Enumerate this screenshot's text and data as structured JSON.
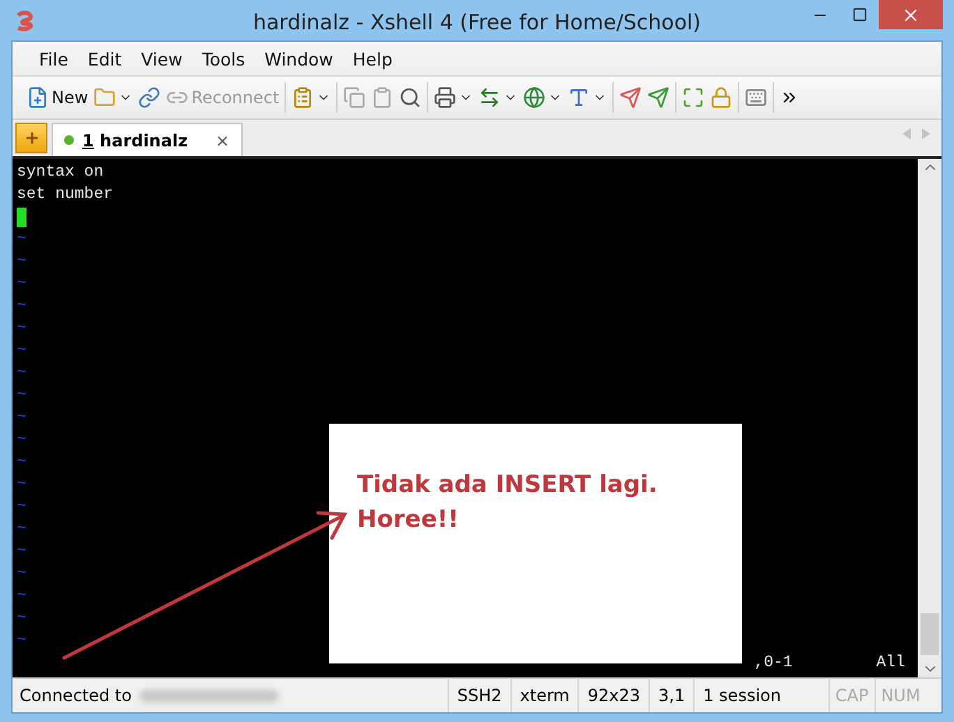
{
  "window": {
    "title": "hardinalz - Xshell 4 (Free for Home/School)"
  },
  "menu": [
    "File",
    "Edit",
    "View",
    "Tools",
    "Window",
    "Help"
  ],
  "toolbar": {
    "new_button": {
      "label": "New"
    },
    "reconnect_button": {
      "label": "Reconnect",
      "disabled": true
    }
  },
  "tabs": [
    {
      "number": "1",
      "label": "hardinalz",
      "selected": true,
      "connected": true,
      "close": "×"
    }
  ],
  "terminal": {
    "lines": [
      "syntax on",
      "set number"
    ],
    "cursor": true,
    "tildes": [
      "~",
      "~",
      "~",
      "~",
      "~",
      "~",
      "~",
      "~",
      "~",
      "~",
      "~",
      "~",
      "~",
      "~",
      "~",
      "~",
      "~",
      "~",
      "~"
    ],
    "ruler": ",0-1",
    "position": "All"
  },
  "annotation": {
    "lines": [
      "Tidak ada INSERT lagi.",
      "Horee!!"
    ]
  },
  "status_bar": {
    "message": "Connected to",
    "cells": [
      "SSH2",
      "xterm",
      "92x23",
      "3,1",
      "1 session"
    ],
    "indicators": [
      {
        "label": "CAP",
        "on": false
      },
      {
        "label": "NUM",
        "on": false
      }
    ]
  }
}
